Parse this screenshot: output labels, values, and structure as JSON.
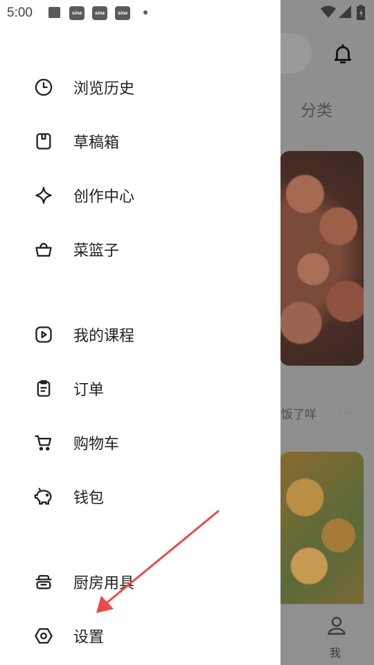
{
  "status_bar": {
    "time": "5:00",
    "notification_icons": [
      "image-icon",
      "sina-weibo-icon",
      "sina-weibo-icon",
      "sina-weibo-icon",
      "dot-icon"
    ],
    "sina_text": "sina"
  },
  "background_app": {
    "tab_label": "分类",
    "post_caption": "饭了咩",
    "more_dots": "···",
    "bottom_nav_label": "我"
  },
  "drawer": {
    "items": [
      {
        "label": "浏览历史",
        "icon": "clock-icon"
      },
      {
        "label": "草稿箱",
        "icon": "draft-box-icon"
      },
      {
        "label": "创作中心",
        "icon": "sparkle-icon"
      },
      {
        "label": "菜篮子",
        "icon": "basket-icon"
      },
      {
        "label": "我的课程",
        "icon": "play-course-icon"
      },
      {
        "label": "订单",
        "icon": "clipboard-icon"
      },
      {
        "label": "购物车",
        "icon": "cart-icon"
      },
      {
        "label": "钱包",
        "icon": "piggy-bank-icon"
      },
      {
        "label": "厨房用具",
        "icon": "cookware-icon"
      },
      {
        "label": "设置",
        "icon": "settings-hexagon-icon"
      }
    ]
  },
  "annotation": {
    "arrow_color": "#f04848"
  }
}
